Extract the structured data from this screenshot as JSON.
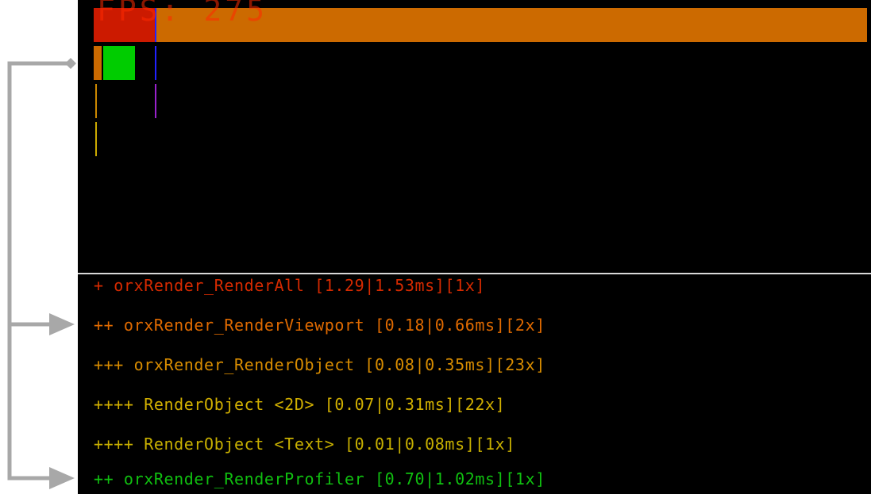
{
  "overlay": {
    "fps_text": "FPS: 275"
  },
  "rows": [
    {
      "text": "+ orxRender_RenderAll [1.29|1.53ms][1x]",
      "color": "#d62a00"
    },
    {
      "text": "++ orxRender_RenderViewport [0.18|0.66ms][2x]",
      "color": "#e06a00"
    },
    {
      "text": "+++ orxRender_RenderObject [0.08|0.35ms][23x]",
      "color": "#d88c00"
    },
    {
      "text": "++++ RenderObject <2D> [0.07|0.31ms][22x]",
      "color": "#d2b000"
    },
    {
      "text": "++++ RenderObject <Text> [0.01|0.08ms][1x]",
      "color": "#c8b000"
    },
    {
      "text": "++ orxRender_RenderProfiler [0.70|1.02ms][1x]",
      "color": "#10c010"
    }
  ],
  "colors": {
    "panel": "#000000",
    "render_all": "#cc1a00",
    "render_viewport": "#cc6a00",
    "render_object": "#cc8800",
    "render_object_2d": "#ccaa00",
    "render_profiler": "#00cc00",
    "marker_blue": "#2222ff",
    "marker_purple": "#9922cc",
    "arrows": "#a8a8a8",
    "divider": "#d8d8d8"
  }
}
